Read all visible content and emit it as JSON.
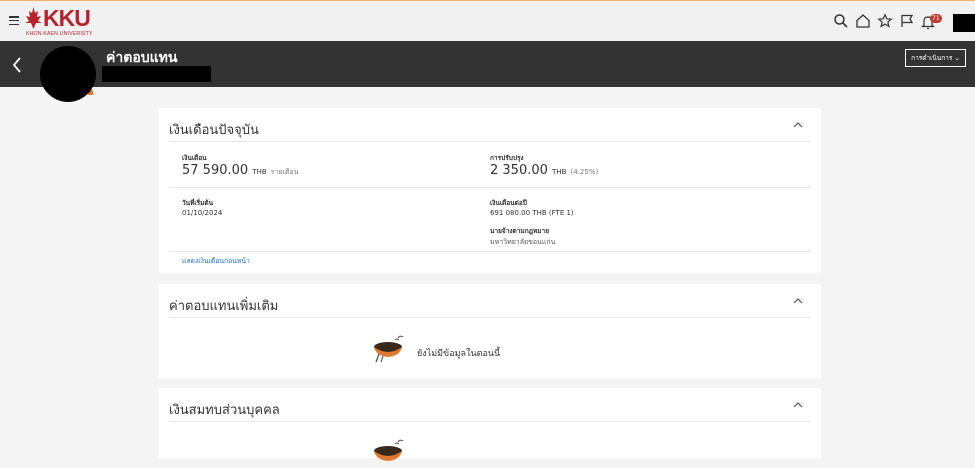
{
  "topbar": {
    "logo_text": "KKU",
    "logo_subtext": "KHON KAEN UNIVERSITY",
    "notification_count": "71",
    "icons": [
      "menu-icon",
      "search-icon",
      "home-icon",
      "star-icon",
      "flag-icon",
      "bell-icon"
    ]
  },
  "header": {
    "title": "ค่าตอบแทน",
    "action_label": "การดำเนินการ ⌄"
  },
  "current_salary": {
    "title": "เงินเดือนปัจจุบัน",
    "salary_label": "เงินเดือน",
    "salary_value": "57 590.00",
    "salary_currency": "THB",
    "salary_period": "รายเดือน",
    "adjustment_label": "การปรับปรุง",
    "adjustment_value": "2 350.00",
    "adjustment_currency": "THB",
    "adjustment_percent": "(4.25%)",
    "start_date_label": "วันที่เริ่มต้น",
    "start_date_value": "01/10/2024",
    "annual_label": "เงินเดือนต่อปี",
    "annual_value": "691 080.00",
    "annual_currency": "THB",
    "annual_fte": "(FTE 1)",
    "employer_label": "นายจ้างตามกฎหมาย",
    "employer_value": "มหาวิทยาลัยขอนแก่น",
    "previous_link": "แสดงเงินเดือนก่อนหน้า"
  },
  "additional_comp": {
    "title": "ค่าตอบแทนเพิ่มเติม",
    "empty_message": "ยังไม่มีข้อมูลในตอนนี้"
  },
  "personal_contrib": {
    "title": "เงินสมทบส่วนบุคคล"
  }
}
